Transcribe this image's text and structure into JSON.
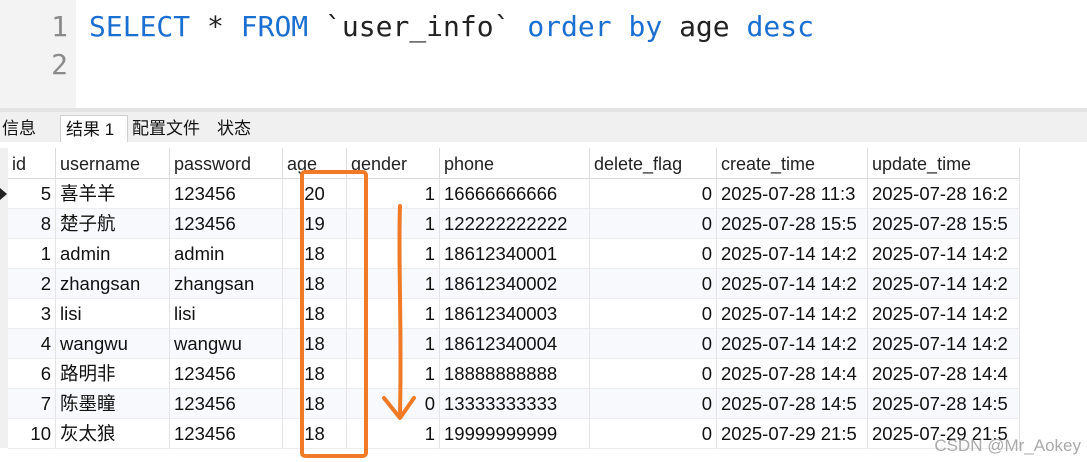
{
  "editor": {
    "line_numbers": [
      "1",
      "2"
    ],
    "sql": {
      "select": "SELECT",
      "star": "*",
      "from": "FROM",
      "table": "`user_info`",
      "order": "order",
      "by": "by",
      "column": "age",
      "direction": "desc"
    }
  },
  "tabs": [
    {
      "label": "信息"
    },
    {
      "label": "结果 1",
      "active": true
    },
    {
      "label": "配置文件"
    },
    {
      "label": "状态"
    }
  ],
  "columns": [
    "id",
    "username",
    "password",
    "age",
    "gender",
    "phone",
    "delete_flag",
    "create_time",
    "update_time"
  ],
  "rows": [
    {
      "id": "5",
      "username": "喜羊羊",
      "password": "123456",
      "age": "20",
      "gender": "1",
      "phone": "16666666666",
      "delete_flag": "0",
      "create_time": "2025-07-28 11:3",
      "update_time": "2025-07-28 16:2"
    },
    {
      "id": "8",
      "username": "楚子航",
      "password": "123456",
      "age": "19",
      "gender": "1",
      "phone": "122222222222",
      "delete_flag": "0",
      "create_time": "2025-07-28 15:5",
      "update_time": "2025-07-28 15:5"
    },
    {
      "id": "1",
      "username": "admin",
      "password": "admin",
      "age": "18",
      "gender": "1",
      "phone": "18612340001",
      "delete_flag": "0",
      "create_time": "2025-07-14 14:2",
      "update_time": "2025-07-14 14:2"
    },
    {
      "id": "2",
      "username": "zhangsan",
      "password": "zhangsan",
      "age": "18",
      "gender": "1",
      "phone": "18612340002",
      "delete_flag": "0",
      "create_time": "2025-07-14 14:2",
      "update_time": "2025-07-14 14:2"
    },
    {
      "id": "3",
      "username": "lisi",
      "password": "lisi",
      "age": "18",
      "gender": "1",
      "phone": "18612340003",
      "delete_flag": "0",
      "create_time": "2025-07-14 14:2",
      "update_time": "2025-07-14 14:2"
    },
    {
      "id": "4",
      "username": "wangwu",
      "password": "wangwu",
      "age": "18",
      "gender": "1",
      "phone": "18612340004",
      "delete_flag": "0",
      "create_time": "2025-07-14 14:2",
      "update_time": "2025-07-14 14:2"
    },
    {
      "id": "6",
      "username": "路明非",
      "password": "123456",
      "age": "18",
      "gender": "1",
      "phone": "18888888888",
      "delete_flag": "0",
      "create_time": "2025-07-28 14:4",
      "update_time": "2025-07-28 14:4"
    },
    {
      "id": "7",
      "username": "陈墨瞳",
      "password": "123456",
      "age": "18",
      "gender": "0",
      "phone": "13333333333",
      "delete_flag": "0",
      "create_time": "2025-07-28 14:5",
      "update_time": "2025-07-28 14:5"
    },
    {
      "id": "10",
      "username": "灰太狼",
      "password": "123456",
      "age": "18",
      "gender": "1",
      "phone": "19999999999",
      "delete_flag": "0",
      "create_time": "2025-07-29 21:5",
      "update_time": "2025-07-29 21:5"
    }
  ],
  "colors": {
    "keyword": "#1a6fd0",
    "annotation": "#f07a26"
  },
  "watermark": "CSDN @Mr_Aokey"
}
